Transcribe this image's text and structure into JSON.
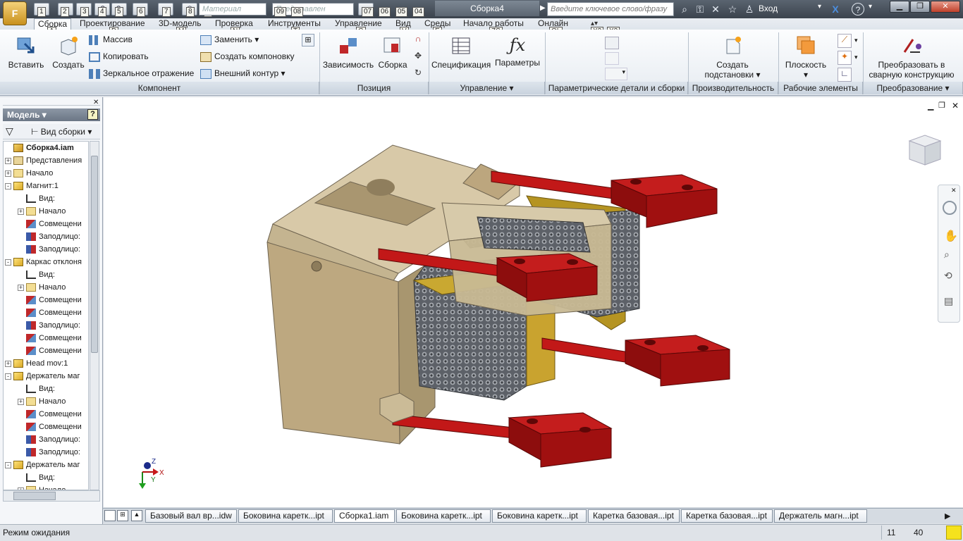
{
  "app": {
    "doc_title": "Сборка4",
    "app_button": "F",
    "material_placeholder": "Материал",
    "representation_placeholder": "Представлен",
    "search_placeholder": "Введите ключевое слово/фразу",
    "login_label": "Вход"
  },
  "qat_keytips": [
    "1",
    "2",
    "3",
    "4",
    "5",
    "6",
    "7",
    "8",
    "9",
    "09",
    "08",
    "07",
    "06",
    "05",
    "04"
  ],
  "ribbon_tabs": [
    {
      "label": "Сборка",
      "keytip": "A",
      "selected": true
    },
    {
      "label": "Проектирование",
      "keytip": "D"
    },
    {
      "label": "3D-модель",
      "keytip": "M"
    },
    {
      "label": "Проверка",
      "keytip": "N"
    },
    {
      "label": "Инструменты",
      "keytip": "T"
    },
    {
      "label": "Управление",
      "keytip": "G"
    },
    {
      "label": "Вид",
      "keytip": "V"
    },
    {
      "label": "Среды",
      "keytip": "E"
    },
    {
      "label": "Начало работы",
      "keytip": "ZS"
    },
    {
      "label": "Онлайн",
      "keytip": "OL"
    }
  ],
  "extra_keytips": [
    "X2",
    "X3"
  ],
  "ribbon": {
    "insert": "Вставить",
    "create": "Создать",
    "pattern": "Массив",
    "copy": "Копировать",
    "mirror": "Зеркальное отражение",
    "replace": "Заменить",
    "create_layout": "Создать компоновку",
    "shrinkwrap": "Внешний контур",
    "constraint": "Зависимость",
    "assemble": "Сборка",
    "bom": "Спецификация",
    "parameters": "Параметры",
    "create_substitute_1": "Создать",
    "create_substitute_2": "подстановки",
    "plane": "Плоскость",
    "convert_weldment_1": "Преобразовать в",
    "convert_weldment_2": "сварную конструкцию",
    "groups": {
      "component": "Компонент",
      "position": "Позиция",
      "manage": "Управление",
      "parametric": "Параметрические детали и сборки",
      "productivity": "Производительность",
      "work_features": "Рабочие элементы",
      "convert": "Преобразование"
    }
  },
  "browser": {
    "title": "Модель",
    "view_label": "Вид сборки",
    "tree": [
      {
        "label": "Сборка4.iam",
        "level": 0,
        "icon": "assembly",
        "expander": "",
        "bold": true
      },
      {
        "label": "Представления",
        "level": 0,
        "icon": "representations",
        "expander": "+"
      },
      {
        "label": "Начало",
        "level": 0,
        "icon": "folder",
        "expander": "+"
      },
      {
        "label": "Магнит:1",
        "level": 0,
        "icon": "part",
        "expander": "-"
      },
      {
        "label": "Вид:",
        "level": 1,
        "icon": "view",
        "expander": ""
      },
      {
        "label": "Начало",
        "level": 1,
        "icon": "folder",
        "expander": "+"
      },
      {
        "label": "Совмещени",
        "level": 1,
        "icon": "mate",
        "expander": ""
      },
      {
        "label": "Заподлицо:",
        "level": 1,
        "icon": "flush",
        "expander": ""
      },
      {
        "label": "Заподлицо:",
        "level": 1,
        "icon": "flush",
        "expander": ""
      },
      {
        "label": "Каркас отклоня",
        "level": 0,
        "icon": "part",
        "expander": "-"
      },
      {
        "label": "Вид:",
        "level": 1,
        "icon": "view",
        "expander": ""
      },
      {
        "label": "Начало",
        "level": 1,
        "icon": "folder",
        "expander": "+"
      },
      {
        "label": "Совмещени",
        "level": 1,
        "icon": "mate",
        "expander": ""
      },
      {
        "label": "Совмещени",
        "level": 1,
        "icon": "mate",
        "expander": ""
      },
      {
        "label": "Заподлицо:",
        "level": 1,
        "icon": "flush",
        "expander": ""
      },
      {
        "label": "Совмещени",
        "level": 1,
        "icon": "mate",
        "expander": ""
      },
      {
        "label": "Совмещени",
        "level": 1,
        "icon": "mate",
        "expander": ""
      },
      {
        "label": "Head mov:1",
        "level": 0,
        "icon": "part",
        "expander": "+"
      },
      {
        "label": "Держатель маг",
        "level": 0,
        "icon": "part",
        "expander": "-"
      },
      {
        "label": "Вид:",
        "level": 1,
        "icon": "view",
        "expander": ""
      },
      {
        "label": "Начало",
        "level": 1,
        "icon": "folder",
        "expander": "+"
      },
      {
        "label": "Совмещени",
        "level": 1,
        "icon": "mate",
        "expander": ""
      },
      {
        "label": "Совмещени",
        "level": 1,
        "icon": "mate",
        "expander": ""
      },
      {
        "label": "Заподлицо:",
        "level": 1,
        "icon": "flush",
        "expander": ""
      },
      {
        "label": "Заподлицо:",
        "level": 1,
        "icon": "flush",
        "expander": ""
      },
      {
        "label": "Держатель маг",
        "level": 0,
        "icon": "part",
        "expander": "-"
      },
      {
        "label": "Вид:",
        "level": 1,
        "icon": "view",
        "expander": ""
      },
      {
        "label": "Начало",
        "level": 1,
        "icon": "folder",
        "expander": "+"
      }
    ]
  },
  "doc_tabs": [
    "Базовый вал вр...idw",
    "Боковина каретк...ipt",
    "Сборка1.iam",
    "Боковина каретк...ipt",
    "Боковина каретк...ipt",
    "Каретка базовая...ipt",
    "Каретка базовая...ipt",
    "Держатель магн...ipt"
  ],
  "status": {
    "text": "Режим ожидания",
    "count1": "11",
    "count2": "40"
  },
  "axes": {
    "x": "X",
    "y": "Y",
    "z": "Z"
  },
  "colors": {
    "body": "#c8b89a",
    "red": "#b01010",
    "yellow": "#c9a531",
    "mesh": "#6f737a"
  }
}
